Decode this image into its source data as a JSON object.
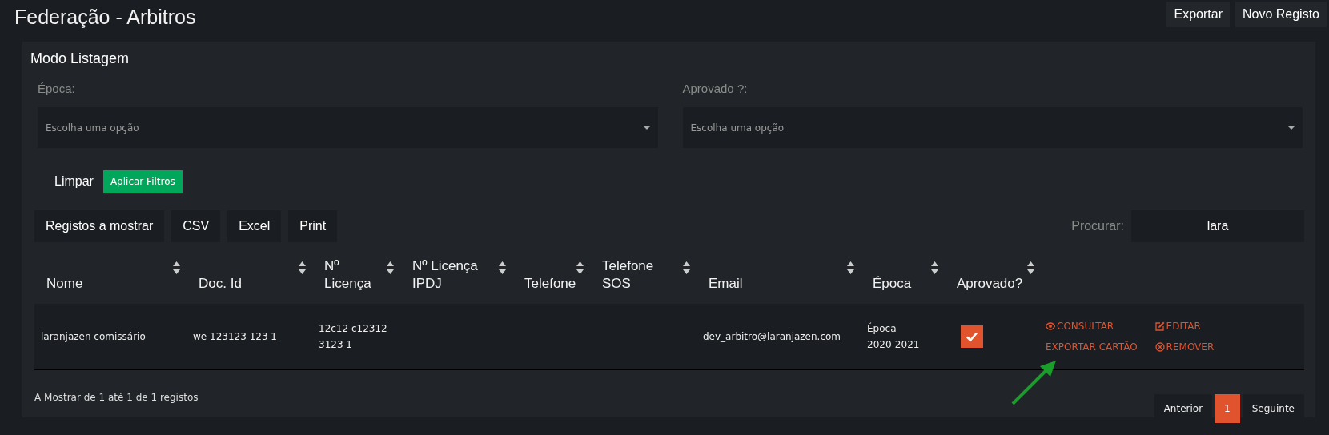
{
  "page_title": "Federação - Arbitros",
  "header_buttons": [
    "Exportar",
    "Novo Registo"
  ],
  "panel": {
    "title": "Modo Listagem",
    "filters": [
      {
        "label": "Época:",
        "placeholder": "Escolha uma opção"
      },
      {
        "label": "Aprovado ?:",
        "placeholder": "Escolha uma opção"
      }
    ],
    "filter_actions": {
      "clear": "Limpar",
      "apply": "Aplicar Filtros"
    },
    "table_buttons": [
      "Registos a mostrar",
      "CSV",
      "Excel",
      "Print"
    ],
    "search": {
      "label": "Procurar:",
      "value": "lara"
    },
    "table": {
      "columns": [
        {
          "label": "Nome",
          "sortable": true
        },
        {
          "label": "Doc. Id",
          "sortable": true
        },
        {
          "label": "Nº Licença",
          "sortable": true
        },
        {
          "label": "Nº Licença IPDJ",
          "sortable": true
        },
        {
          "label": "Telefone",
          "sortable": true
        },
        {
          "label": "Telefone SOS",
          "sortable": true
        },
        {
          "label": "Email",
          "sortable": true
        },
        {
          "label": "Época",
          "sortable": true
        },
        {
          "label": "Aprovado?",
          "sortable": true
        }
      ],
      "rows": [
        {
          "nome": "laranjazen comissário",
          "doc_id": "we 123123 123 1",
          "licenca": "12c12 c12312 3123 1",
          "email": "dev_arbitro@laranjazen.com",
          "epoca": "Época 2020-2021",
          "aprovado": true,
          "actions": [
            {
              "kind": "view",
              "label": "CONSULTAR"
            },
            {
              "kind": "edit",
              "label": "EDITAR"
            },
            {
              "kind": "export",
              "label": "EXPORTAR CARTÃO"
            },
            {
              "kind": "remove",
              "label": "REMOVER"
            }
          ]
        }
      ]
    },
    "info": "A Mostrar de 1 até 1 de 1 registos",
    "pagination": [
      {
        "label": "Anterior",
        "selected": false
      },
      {
        "label": "1",
        "selected": true
      },
      {
        "label": "Seguinte",
        "selected": false
      }
    ]
  }
}
